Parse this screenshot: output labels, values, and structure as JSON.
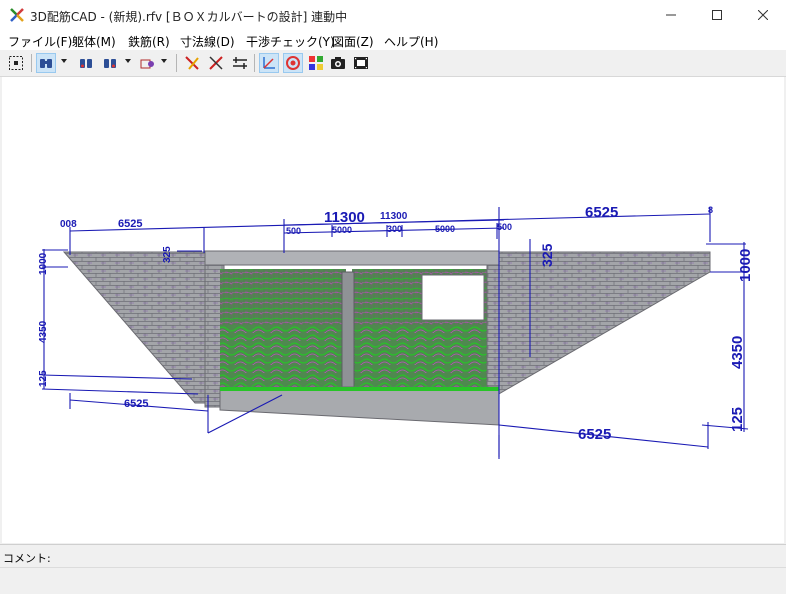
{
  "window": {
    "title": "3D配筋CAD - (新規).rfv [ＢＯＸカルバートの設計] 連動中"
  },
  "menu": {
    "items": [
      {
        "id": "file",
        "label": "ファイル(F)"
      },
      {
        "id": "body",
        "label": "躯体(M)"
      },
      {
        "id": "rebar",
        "label": "鉄筋(R)"
      },
      {
        "id": "dim",
        "label": "寸法線(D)"
      },
      {
        "id": "check",
        "label": "干渉チェック(Y)"
      },
      {
        "id": "drawing",
        "label": "図面(Z)"
      },
      {
        "id": "help",
        "label": "ヘルプ(H)"
      }
    ]
  },
  "toolbar": {
    "icons": [
      "select-all-icon",
      "view-binoculars-icon",
      "view-front-icon",
      "view-side-icon",
      "render-mode-icon",
      "rebar-check-icon",
      "cross-check-icon",
      "align-icon",
      "axis-icon",
      "target-icon",
      "color-palette-icon",
      "camera-icon",
      "movie-icon"
    ]
  },
  "status": {
    "comment_label": "コメント:"
  },
  "dimensions": {
    "top_total": "11300",
    "top_total_small": "11300",
    "right_wing": "6525",
    "left_wing": "6525",
    "left_wing_bottom": "6525",
    "right_wing_bottom": "6525",
    "top_left_edge": "008",
    "seg_500_a": "500",
    "seg_5000_a": "5000",
    "seg_300": "300",
    "seg_5000_b": "5000",
    "seg_500_b": "500",
    "left_thick": "325",
    "right_thick": "325",
    "left_height_top": "1000",
    "left_height_mid": "4350",
    "left_height_bottom": "125",
    "right_height_top": "1000",
    "right_height_mid": "4350",
    "right_height_bottom": "125",
    "right_edge_small": "8"
  },
  "colors": {
    "dimension_line": "#1a1ab4",
    "concrete": "#9a9ca0",
    "rebar_green": "#2ea82e",
    "rebar_magenta": "#b44fb4"
  }
}
